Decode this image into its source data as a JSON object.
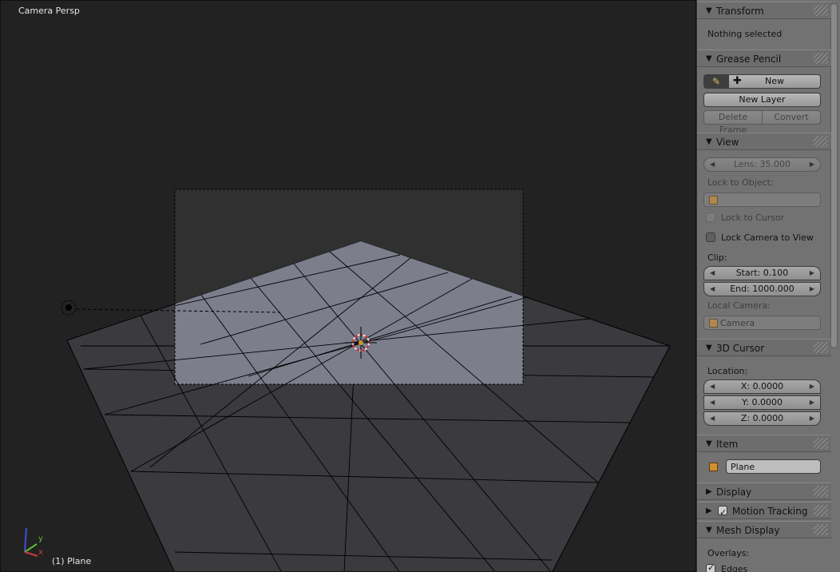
{
  "viewport": {
    "title": "Camera Persp",
    "object_label": "(1) Plane",
    "axis": {
      "y": "y",
      "x": "x",
      "z": "z"
    }
  },
  "sidebar": {
    "transform": {
      "title": "Transform",
      "status": "Nothing selected"
    },
    "grease_pencil": {
      "title": "Grease Pencil",
      "new_label": "New",
      "new_layer_label": "New Layer",
      "delete_frame_label": "Delete Frame",
      "convert_label": "Convert",
      "pencil_icon": "pencil-icon",
      "plus_icon": "plus-icon"
    },
    "view": {
      "title": "View",
      "lens": "Lens: 35.000",
      "lock_object_label": "Lock to Object:",
      "lock_cursor_label": "Lock to Cursor",
      "lock_camera_label": "Lock Camera to View",
      "clip_label": "Clip:",
      "clip_start": "Start: 0.100",
      "clip_end": "End: 1000.000",
      "local_camera_label": "Local Camera:",
      "local_camera_value": "Camera"
    },
    "cursor": {
      "title": "3D Cursor",
      "location_label": "Location:",
      "x": "X: 0.0000",
      "y": "Y: 0.0000",
      "z": "Z: 0.0000"
    },
    "item": {
      "title": "Item",
      "name": "Plane"
    },
    "display": {
      "title": "Display"
    },
    "motion_tracking": {
      "title": "Motion Tracking"
    },
    "mesh_display": {
      "title": "Mesh Display",
      "overlays_label": "Overlays:",
      "edges_label": "Edges"
    }
  }
}
